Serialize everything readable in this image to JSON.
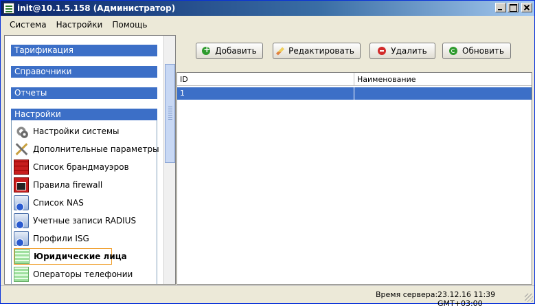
{
  "window": {
    "title": "init@10.1.5.158 (Администратор)",
    "accent": "#0a246a"
  },
  "menu": {
    "items": [
      "Система",
      "Настройки",
      "Помощь"
    ]
  },
  "sidebar": {
    "sections": [
      {
        "label": "Тарификация"
      },
      {
        "label": "Справочники"
      },
      {
        "label": "Отчеты"
      },
      {
        "label": "Настройки"
      }
    ],
    "items": [
      {
        "label": "Настройки системы",
        "icon": "gear-icon"
      },
      {
        "label": "Дополнительные параметры",
        "icon": "tools-icon"
      },
      {
        "label": "Список брандмауэров",
        "icon": "firewall-icon"
      },
      {
        "label": "Правила firewall",
        "icon": "firewall-rule-icon"
      },
      {
        "label": "Список NAS",
        "icon": "server-icon"
      },
      {
        "label": "Учетные записи RADIUS",
        "icon": "server-icon"
      },
      {
        "label": "Профили ISG",
        "icon": "server-icon"
      },
      {
        "label": "Юридические лица",
        "icon": "green-doc-icon",
        "selected": true
      },
      {
        "label": "Операторы телефонии",
        "icon": "green-doc-icon"
      }
    ],
    "header_color": "#3c6fc7"
  },
  "toolbar": {
    "add_label": "Добавить",
    "edit_label": "Редактировать",
    "delete_label": "Удалить",
    "refresh_label": "Обновить"
  },
  "table": {
    "columns": [
      "ID",
      "Наименование"
    ],
    "rows": [
      {
        "id": "1",
        "name": "",
        "selected": true
      }
    ],
    "selection_color": "#3c6fc7"
  },
  "status": {
    "label": "Время сервера:",
    "value": "23.12.16 11:39 GMT+03:00"
  }
}
